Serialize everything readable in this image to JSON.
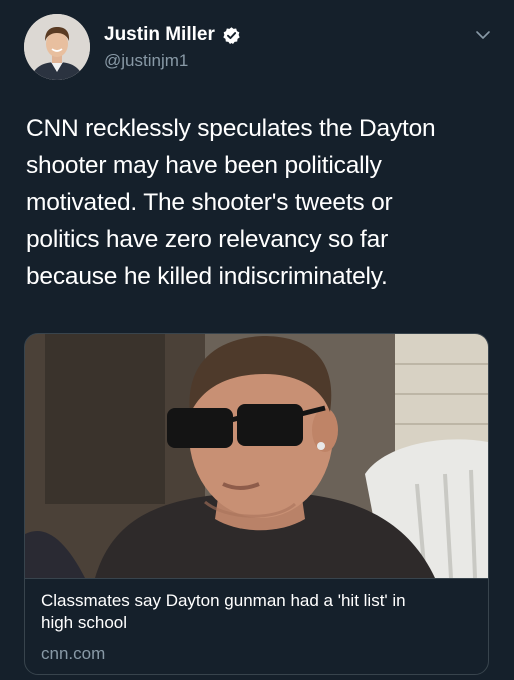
{
  "tweet": {
    "author": {
      "display_name": "Justin Miller",
      "handle": "@justinjm1",
      "verified": true,
      "avatar": "profile-photo"
    },
    "text_lines": [
      "CNN recklessly speculates the Dayton",
      "shooter may have been politically",
      "motivated. The shooter's tweets or",
      "politics have zero relevancy so far",
      "because he killed indiscriminately."
    ],
    "card": {
      "image": "news-photo",
      "title_lines": [
        "Classmates say Dayton gunman had a 'hit list' in",
        "high school"
      ],
      "domain": "cnn.com"
    }
  },
  "colors": {
    "background": "#15202b",
    "text_primary": "#ffffff",
    "text_secondary": "#8899a6",
    "border": "#38444d",
    "verified_badge": "#ffffff"
  },
  "icons": [
    "verified-badge-icon",
    "chevron-down-icon"
  ]
}
